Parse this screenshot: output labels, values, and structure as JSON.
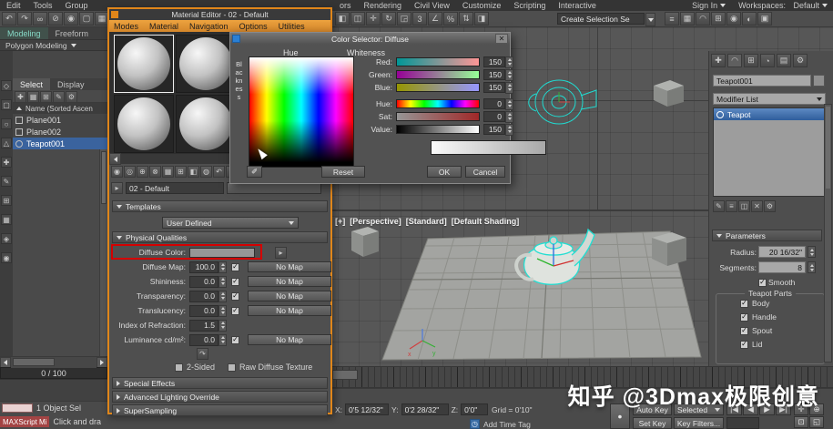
{
  "colors": {
    "accent_orange": "#e0861a",
    "selection_blue": "#3a639e",
    "highlight_red": "#d40000",
    "wire_teal": "#19d8d0"
  },
  "menubar": {
    "left": [
      "Edit",
      "Tools",
      "Group"
    ],
    "right": [
      "ors",
      "Rendering",
      "Civil View",
      "Customize",
      "Scripting",
      "Interactive"
    ],
    "sign_in": "Sign In",
    "workspaces_label": "Workspaces:",
    "workspaces_value": "Default"
  },
  "toolbar": {
    "create_selection_set": "Create Selection Se"
  },
  "material_editor": {
    "title": "Material Editor - 02 - Default",
    "menus": [
      "Modes",
      "Material",
      "Navigation",
      "Options",
      "Utilities"
    ],
    "material_name": "02 - Default",
    "templates_rollout": "Templates",
    "templates_value": "User Defined",
    "physical_rollout": "Physical Qualities",
    "params": [
      {
        "label": "Diffuse Color:"
      },
      {
        "label": "Diffuse Map:",
        "value": "100.0",
        "map": "No Map"
      },
      {
        "label": "Shininess:",
        "value": "0.0",
        "map": "No Map"
      },
      {
        "label": "Transparency:",
        "value": "0.0",
        "map": "No Map"
      },
      {
        "label": "Translucency:",
        "value": "0.0",
        "map": "No Map"
      },
      {
        "label": "Index of Refraction:",
        "value": "1.5"
      },
      {
        "label": "Luminance cd/m²:",
        "value": "0.0",
        "map": "No Map"
      }
    ],
    "diffuse_swatch_color": "rgb(150,150,150)",
    "two_sided": "2-Sided",
    "raw_diffuse": "Raw Diffuse Texture",
    "rollouts_collapsed": [
      "Special Effects",
      "Advanced Lighting Override",
      "SuperSampling"
    ]
  },
  "color_selector": {
    "title": "Color Selector: Diffuse",
    "hue": "Hue",
    "whiteness": "Whiteness",
    "blackness": "Blackness",
    "sliders": [
      {
        "label": "Red:",
        "value": "150"
      },
      {
        "label": "Green:",
        "value": "150"
      },
      {
        "label": "Blue:",
        "value": "150"
      },
      {
        "label": "Hue:",
        "value": "0"
      },
      {
        "label": "Sat:",
        "value": "0"
      },
      {
        "label": "Value:",
        "value": "150"
      }
    ],
    "reset": "Reset",
    "ok": "OK",
    "cancel": "Cancel"
  },
  "ribbon": {
    "tabs": [
      "Modeling",
      "Freeform"
    ],
    "panel": "Polygon Modeling"
  },
  "explorer": {
    "tabs": [
      "Select",
      "Display"
    ],
    "header": "Name (Sorted Ascen",
    "items": [
      {
        "name": "Plane001"
      },
      {
        "name": "Plane002"
      },
      {
        "name": "Teapot001"
      }
    ],
    "time": "0 / 100",
    "status_selection": "1 Object Sel",
    "maxscript": "MAXScript Mi",
    "prompt": "Click and dra"
  },
  "viewport": {
    "labels": [
      "[+]",
      "[Perspective]",
      "[Standard]",
      "[Default Shading]"
    ]
  },
  "command_panel": {
    "object_name": "Teapot001",
    "modifier_list": "Modifier List",
    "stack": "Teapot",
    "parameters": "Parameters",
    "radius_label": "Radius:",
    "radius_value": "20 16/32\"",
    "segments_label": "Segments:",
    "segments_value": "8",
    "smooth": "Smooth",
    "group": "Teapot Parts",
    "parts": [
      "Body",
      "Handle",
      "Spout",
      "Lid"
    ]
  },
  "status": {
    "x": "X:",
    "x_value": "0'5 12/32\"",
    "y": "Y:",
    "y_value": "0'2 28/32\"",
    "z": "Z:",
    "z_value": "0'0\"",
    "grid": "Grid = 0'10\"",
    "add_time_tag": "Add Time Tag",
    "auto_key": "Auto Key",
    "selected": "Selected",
    "set_key": "Set Key",
    "key_filters": "Key Filters..."
  },
  "watermark": "知乎 @3Dmax极限创意",
  "icons": {
    "check": "✓",
    "close": "✕",
    "undo": "↶",
    "redo": "↷",
    "link": "∞",
    "unlink": "⊘",
    "bind": "◉",
    "select": "▢",
    "select_by_name": "▦",
    "rect_region": "◧",
    "crossing": "◫",
    "move": "✛",
    "rotate": "↻",
    "scale": "◲",
    "snap": "3",
    "angle_snap": "∠",
    "percent_snap": "%",
    "spinner_snap": "⇅",
    "mirror": "◨",
    "align": "≡",
    "layers": "▦",
    "curve_editor": "◠",
    "schematic": "⊞",
    "material_editor": "◉",
    "render_setup": "◐",
    "render_frame": "▣",
    "strip": [
      "◇",
      "▢",
      "○",
      "△",
      "✚",
      "✎",
      "⊞",
      "▦",
      "◈",
      "◉"
    ],
    "explorer_tools": [
      "✚",
      "▦",
      "⊞",
      "✎",
      "⚙"
    ],
    "editor_tools": [
      "◉",
      "◎",
      "⊕",
      "⊗",
      "▦",
      "⊞",
      "◧",
      "◍",
      "↶",
      "▸",
      "✓"
    ],
    "cp_tabs": [
      "✚",
      "◠",
      "⊞",
      "◔",
      "▤",
      "⚙"
    ],
    "stack_tools": [
      "✎",
      "≡",
      "◫",
      "✕",
      "⚙"
    ],
    "transport": [
      "|◀",
      "◀",
      "▶",
      "▶|"
    ],
    "nav": [
      "✛",
      "⊕",
      "⊡",
      "◱"
    ],
    "eyedropper": "✐",
    "clock": "◷",
    "key": "●",
    "sample_arrow": "▸"
  }
}
